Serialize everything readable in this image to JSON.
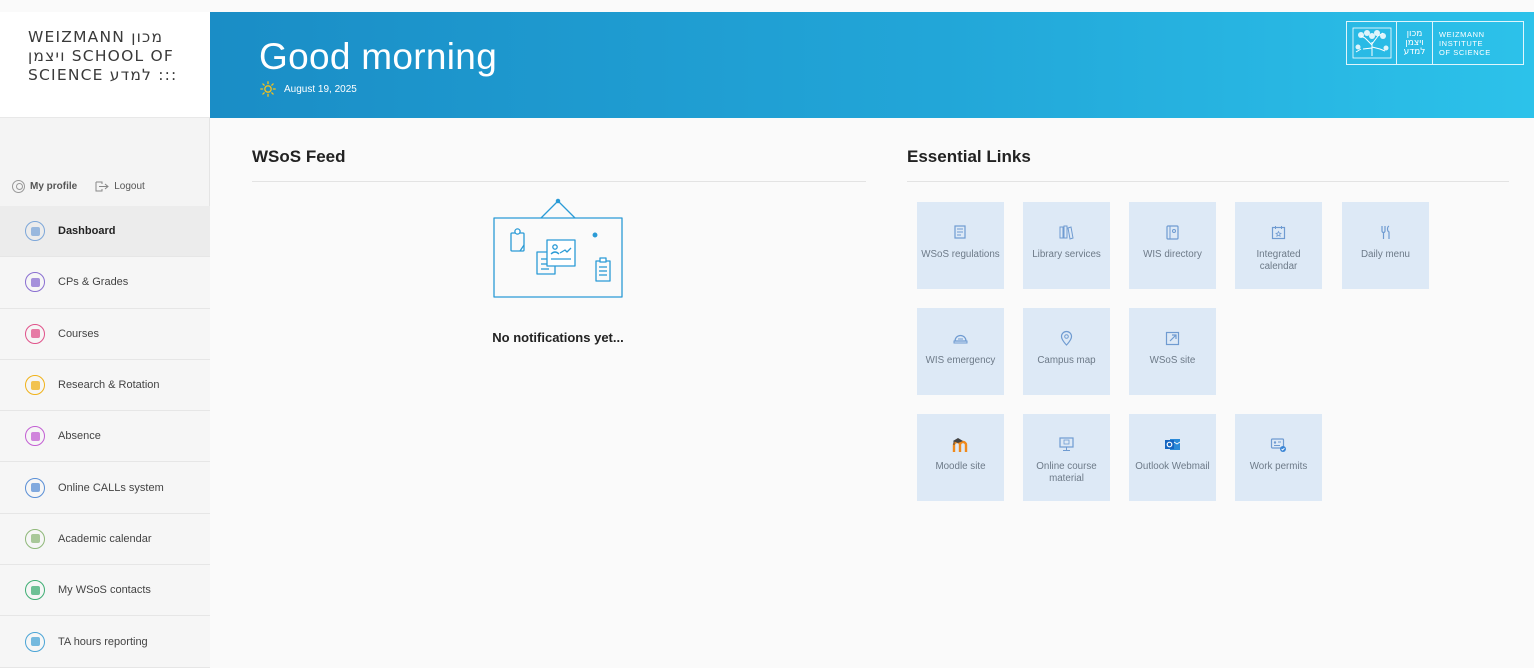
{
  "app": {
    "logo_lines": [
      "WEIZMANN מכון",
      "ויצמן SCHOOL OF",
      "SCIENCE למדע :::"
    ]
  },
  "header": {
    "greeting": "Good morning",
    "date": "August 19, 2025",
    "wis_logo": {
      "hebrew_lines": [
        "מכון",
        "ויצמן",
        "למדע"
      ],
      "english_lines": [
        "WEIZMANN",
        "INSTITUTE",
        "OF SCIENCE"
      ]
    }
  },
  "profile": {
    "my_profile": "My profile",
    "logout": "Logout"
  },
  "sidebar": {
    "items": [
      {
        "label": "Dashboard",
        "icon": "dashboard-icon",
        "color": "#7da7d9",
        "active": true
      },
      {
        "label": "CPs & Grades",
        "icon": "grades-icon",
        "color": "#8a6fd1",
        "active": false
      },
      {
        "label": "Courses",
        "icon": "courses-icon",
        "color": "#e0528a",
        "active": false
      },
      {
        "label": "Research & Rotation",
        "icon": "research-icon",
        "color": "#f0b21a",
        "active": false
      },
      {
        "label": "Absence",
        "icon": "absence-icon",
        "color": "#c35fd3",
        "active": false
      },
      {
        "label": "Online CALLs system",
        "icon": "calls-icon",
        "color": "#5a8fd6",
        "active": false
      },
      {
        "label": "Academic calendar",
        "icon": "calendar-icon",
        "color": "#8fb879",
        "active": false
      },
      {
        "label": "My WSoS contacts",
        "icon": "contacts-icon",
        "color": "#3fae74",
        "active": false
      },
      {
        "label": "TA hours reporting",
        "icon": "ta-hours-icon",
        "color": "#4aa4d6",
        "active": false
      }
    ]
  },
  "feed": {
    "title": "WSoS Feed",
    "empty_message": "No notifications yet..."
  },
  "links": {
    "title": "Essential Links",
    "tiles": [
      {
        "label": "WSoS regulations",
        "icon": "regulations-icon"
      },
      {
        "label": "Library services",
        "icon": "library-icon"
      },
      {
        "label": "WIS directory",
        "icon": "directory-icon"
      },
      {
        "label": "Integrated calendar",
        "icon": "calendar-icon"
      },
      {
        "label": "Daily menu",
        "icon": "cutlery-icon"
      },
      {
        "label": "WIS emergency",
        "icon": "emergency-icon"
      },
      {
        "label": "Campus map",
        "icon": "map-pin-icon"
      },
      {
        "label": "WSoS site",
        "icon": "external-link-icon"
      },
      {
        "label": "Moodle site",
        "icon": "moodle-icon"
      },
      {
        "label": "Online course material",
        "icon": "monitor-icon"
      },
      {
        "label": "Outlook Webmail",
        "icon": "outlook-icon"
      },
      {
        "label": "Work permits",
        "icon": "permit-icon"
      }
    ]
  },
  "colors": {
    "header_start": "#1a8dc6",
    "header_end": "#2cc2ea",
    "tile_bg": "#dde9f6",
    "tile_icon": "#6f9bd1",
    "moodle_orange": "#f08a1c",
    "outlook_blue": "#1565c0"
  }
}
